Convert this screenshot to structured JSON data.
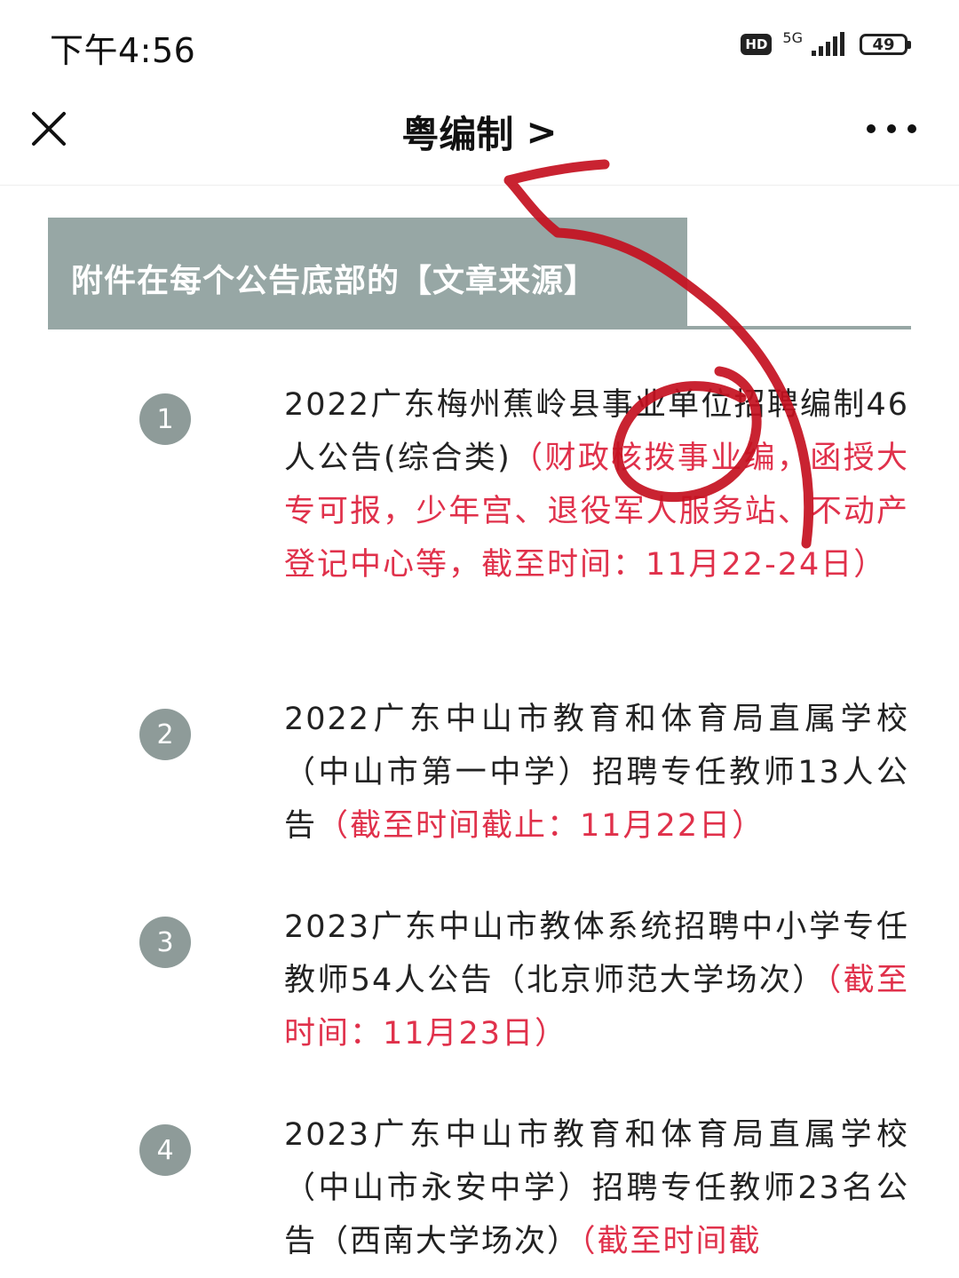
{
  "status": {
    "time": "下午4:56",
    "hd": "HD",
    "network": "5G",
    "battery": "49"
  },
  "nav": {
    "title": "粤编制",
    "title_arrow": ">"
  },
  "banner": {
    "text": "附件在每个公告底部的【文章来源】"
  },
  "items": [
    {
      "number": "1",
      "title": "2022广东梅州蕉岭县事业单位招聘编制46人公告(综合类)",
      "note": "（财政核拨事业编，函授大专可报，少年宫、退役军人服务站、不动产登记中心等，截至时间：11月22-24日）"
    },
    {
      "number": "2",
      "title": "2022广东中山市教育和体育局直属学校（中山市第一中学）招聘专任教师13人公告",
      "note": "（截至时间截止：11月22日）"
    },
    {
      "number": "3",
      "title": "2023广东中山市教体系统招聘中小学专任教师54人公告（北京师范大学场次）",
      "note": "（截至时间：11月23日）"
    },
    {
      "number": "4",
      "title": "2023广东中山市教育和体育局直属学校（中山市永安中学）招聘专任教师23名公告（西南大学场次）",
      "note": "（截至时间截"
    }
  ],
  "colors": {
    "banner_bg": "#97a7a5",
    "badge_bg": "#8e9b99",
    "note_red": "#e0314b",
    "annotation_red": "#c4101f"
  }
}
